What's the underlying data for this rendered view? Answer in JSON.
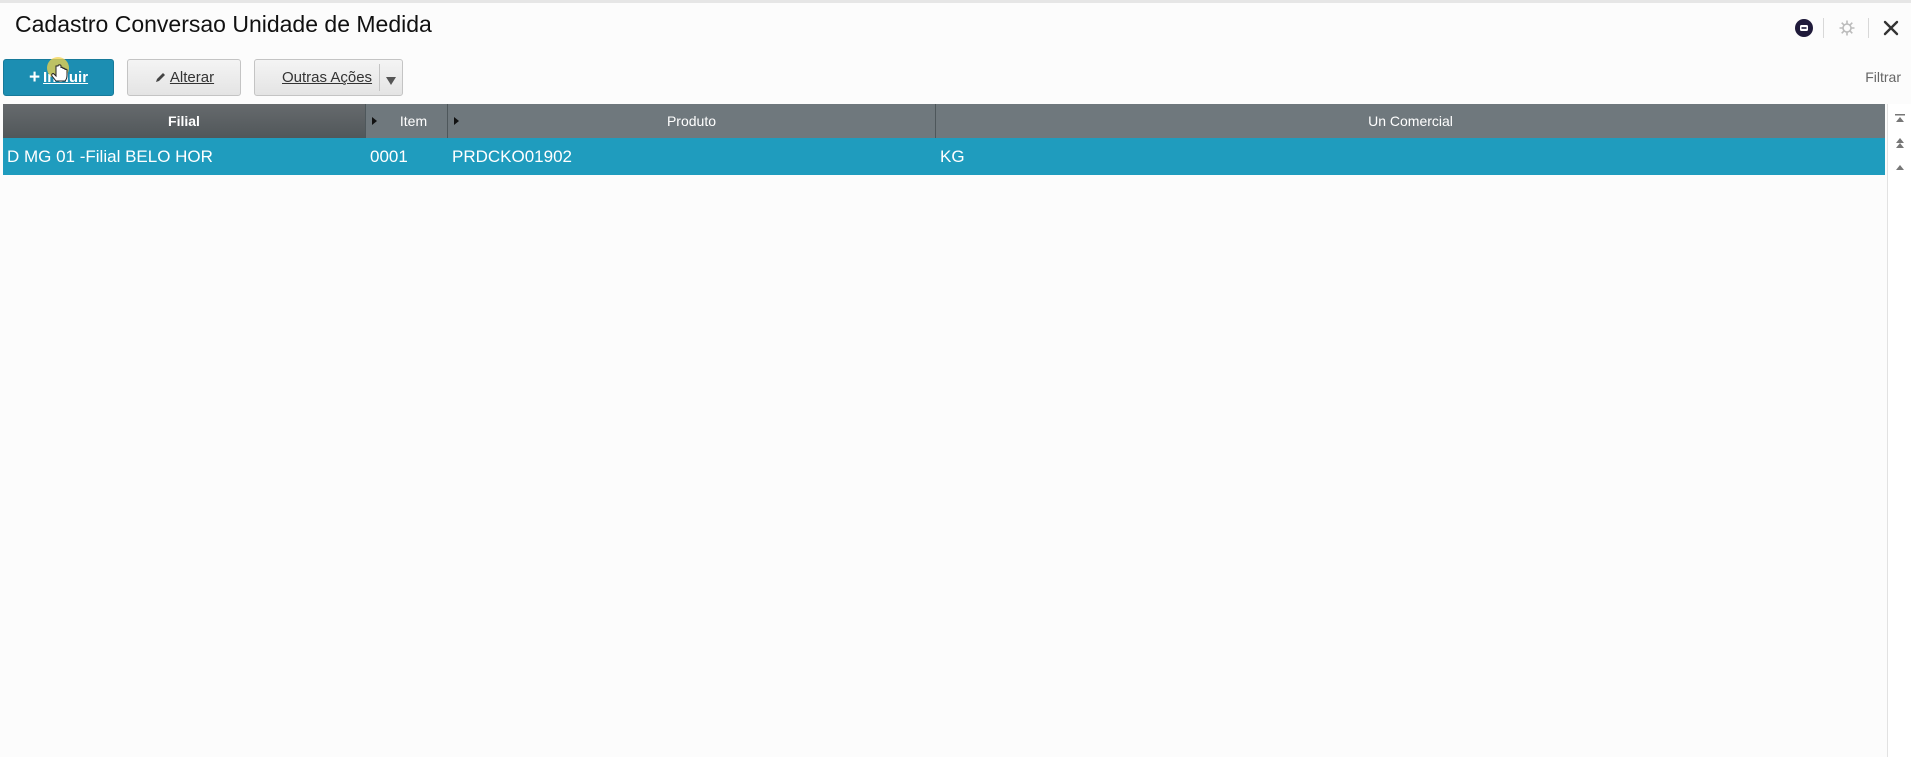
{
  "window": {
    "title": "Cadastro Conversao Unidade de Medida",
    "icons": [
      "browser-badge-icon",
      "gear-icon",
      "close-icon"
    ]
  },
  "toolbar": {
    "add_label": "Incluir",
    "edit_label": "Alterar",
    "more_label": "Outras Ações",
    "filter_label": "Filtrar"
  },
  "grid": {
    "columns": [
      "Filial",
      "Item",
      "Produto",
      "Un Comercial"
    ],
    "sorted_column": "Filial",
    "rows": [
      {
        "filial": "D MG 01 -Filial BELO HOR",
        "item": "0001",
        "produto": "PRDCKO01902",
        "un_comercial": "KG"
      }
    ]
  },
  "colors": {
    "primary_button": "#1c8eb2",
    "selected_row": "#1f9cbe",
    "header": "#6f787d"
  }
}
